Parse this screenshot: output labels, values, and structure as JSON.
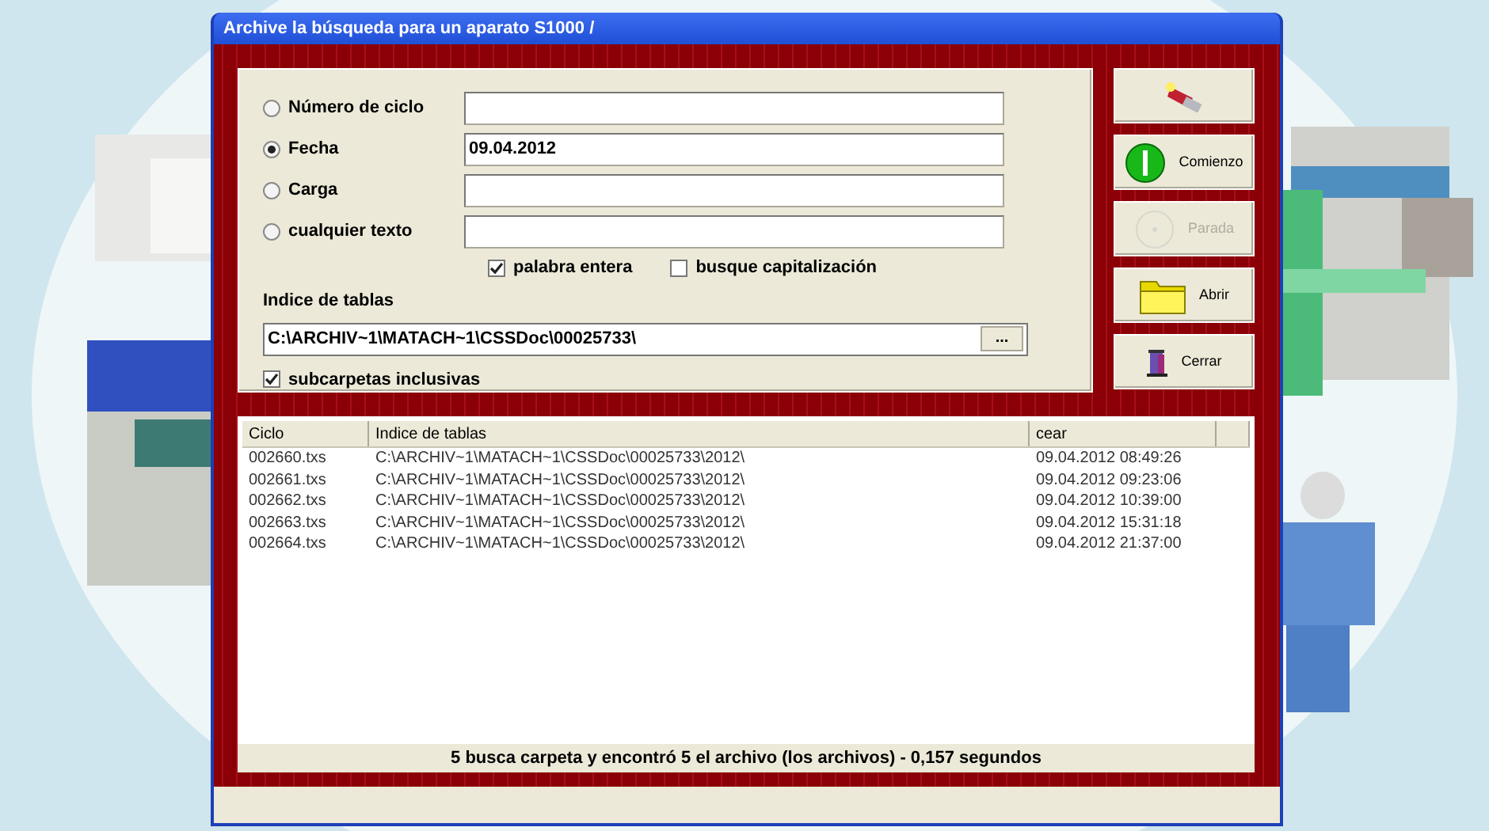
{
  "window": {
    "title": "Archive la búsqueda para un aparato  S1000 /"
  },
  "search_options": [
    {
      "label": "Número de ciclo",
      "selected": false
    },
    {
      "label": "Fecha",
      "selected": true,
      "value": "09.04.2012"
    },
    {
      "label": "Carga",
      "selected": false
    },
    {
      "label": "cualquier texto",
      "selected": false
    }
  ],
  "match_options": [
    {
      "label": "palabra entera",
      "checked": true
    },
    {
      "label": "busque capitalización",
      "checked": false
    }
  ],
  "folder": {
    "label": "Indice de tablas",
    "value": "C:\\ARCHIV~1\\MATACH~1\\CSSDoc\\00025733\\",
    "browse": "...",
    "subfolders": {
      "label": "subcarpetas inclusivas",
      "checked": true
    }
  },
  "buttons": [
    {
      "disabled": false
    },
    {
      "label": "Comienzo",
      "disabled": false
    },
    {
      "label": "Parada",
      "disabled": true
    },
    {
      "label": "Abrir",
      "disabled": false
    },
    {
      "label": "Cerrar",
      "disabled": false
    }
  ],
  "table": {
    "columns": [
      "Ciclo",
      "Indice de tablas",
      "cear"
    ],
    "rows": [
      [
        "002660.txs",
        "C:\\ARCHIV~1\\MATACH~1\\CSSDoc\\00025733\\2012\\",
        "09.04.2012 08:49:26"
      ],
      [
        "002661.txs",
        "C:\\ARCHIV~1\\MATACH~1\\CSSDoc\\00025733\\2012\\",
        "09.04.2012 09:23:06"
      ],
      [
        "002662.txs",
        "C:\\ARCHIV~1\\MATACH~1\\CSSDoc\\00025733\\2012\\",
        "09.04.2012 10:39:00"
      ],
      [
        "002663.txs",
        "C:\\ARCHIV~1\\MATACH~1\\CSSDoc\\00025733\\2012\\",
        "09.04.2012 15:31:18"
      ],
      [
        "002664.txs",
        "C:\\ARCHIV~1\\MATACH~1\\CSSDoc\\00025733\\2012\\",
        "09.04.2012 21:37:00"
      ]
    ]
  },
  "status_bar": "5 busca carpeta y encontró 5 el archivo (los archivos) - 0,157 segundos"
}
